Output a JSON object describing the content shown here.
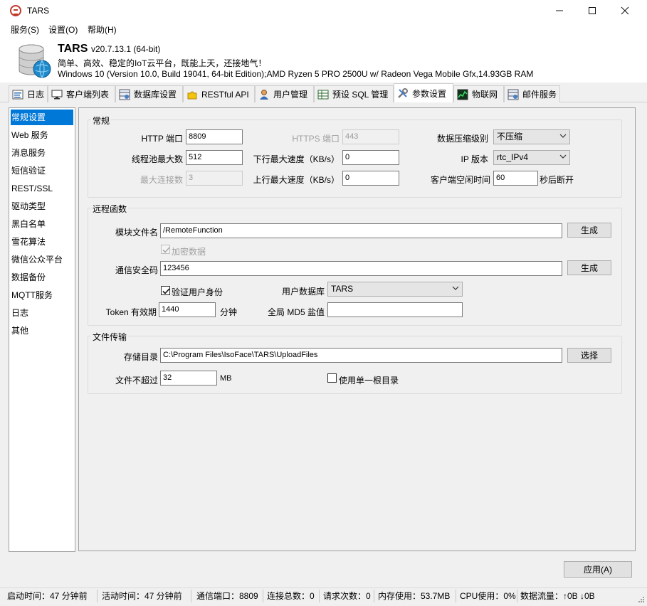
{
  "window": {
    "title": "TARS",
    "minimize_icon": "minimize-icon",
    "maximize_icon": "maximize-icon",
    "close_icon": "close-icon"
  },
  "menu": [
    "服务(S)",
    "设置(O)",
    "帮助(H)"
  ],
  "header": {
    "name": "TARS",
    "version": "v20.7.13.1 (64-bit)",
    "slogan": "简单、高效、稳定的IoT云平台，既能上天，还接地气！",
    "sysinfo": "Windows 10 (Version 10.0, Build 19041, 64-bit Edition);AMD Ryzen 5 PRO 2500U w/ Radeon Vega Mobile Gfx,14.93GB RAM"
  },
  "tabs": [
    {
      "label": "日志",
      "icon": "log-icon"
    },
    {
      "label": "客户端列表",
      "icon": "monitor-icon"
    },
    {
      "label": "数据库设置",
      "icon": "database-settings-icon"
    },
    {
      "label": "RESTful API",
      "icon": "puzzle-icon"
    },
    {
      "label": "用户管理",
      "icon": "user-icon"
    },
    {
      "label": "预设 SQL 管理",
      "icon": "table-icon"
    },
    {
      "label": "参数设置",
      "icon": "tools-icon",
      "active": true
    },
    {
      "label": "物联网",
      "icon": "chart-icon"
    },
    {
      "label": "邮件服务",
      "icon": "mail-settings-icon"
    }
  ],
  "nav": [
    "常规设置",
    "Web 服务",
    "消息服务",
    "短信验证",
    "REST/SSL",
    "驱动类型",
    "黑白名单",
    "雪花算法",
    "微信公众平台",
    "数据备份",
    "MQTT服务",
    "日志",
    "其他"
  ],
  "general": {
    "title": "常规",
    "http_port_label": "HTTP 端口",
    "http_port": "8809",
    "https_port_label": "HTTPS 端口",
    "https_port": "443",
    "compression_label": "数据压缩级别",
    "compression": "不压缩",
    "thread_pool_label": "线程池最大数",
    "thread_pool": "512",
    "down_speed_label": "下行最大速度（KB/s）",
    "down_speed": "0",
    "ip_version_label": "IP 版本",
    "ip_version": "rtc_IPv4",
    "max_conn_label": "最大连接数",
    "max_conn": "3",
    "up_speed_label": "上行最大速度（KB/s）",
    "up_speed": "0",
    "idle_label": "客户端空闲时间",
    "idle": "60",
    "idle_suffix": "秒后断开"
  },
  "remote": {
    "title": "远程函数",
    "module_label": "模块文件名",
    "module": "/RemoteFunction",
    "gen_label": "生成",
    "encrypt_label": "加密数据",
    "secure_code_label": "通信安全码",
    "secure_code": "123456",
    "gen2_label": "生成",
    "verify_label": "验证用户身份",
    "userdb_label": "用户数据库",
    "userdb": "TARS",
    "token_label": "Token 有效期",
    "token": "1440",
    "token_unit": "分钟",
    "md5_label": "全局 MD5 盐值",
    "md5": ""
  },
  "file": {
    "title": "文件传输",
    "dir_label": "存储目录",
    "dir": "C:\\Program Files\\IsoFace\\TARS\\UploadFiles",
    "choose_label": "选择",
    "limit_label": "文件不超过",
    "limit": "32",
    "limit_unit": "MB",
    "single_dir_label": "使用单一根目录"
  },
  "apply_label": "应用(A)",
  "status": {
    "start": "启动时间：47 分钟前",
    "active": "活动时间：47 分钟前",
    "port": "通信端口：8809",
    "conns": "连接总数：0",
    "requests": "请求次数：0",
    "memory": "内存使用：53.7MB",
    "cpu": "CPU使用：0%",
    "traffic": "数据流量：↑0B ↓0B"
  }
}
